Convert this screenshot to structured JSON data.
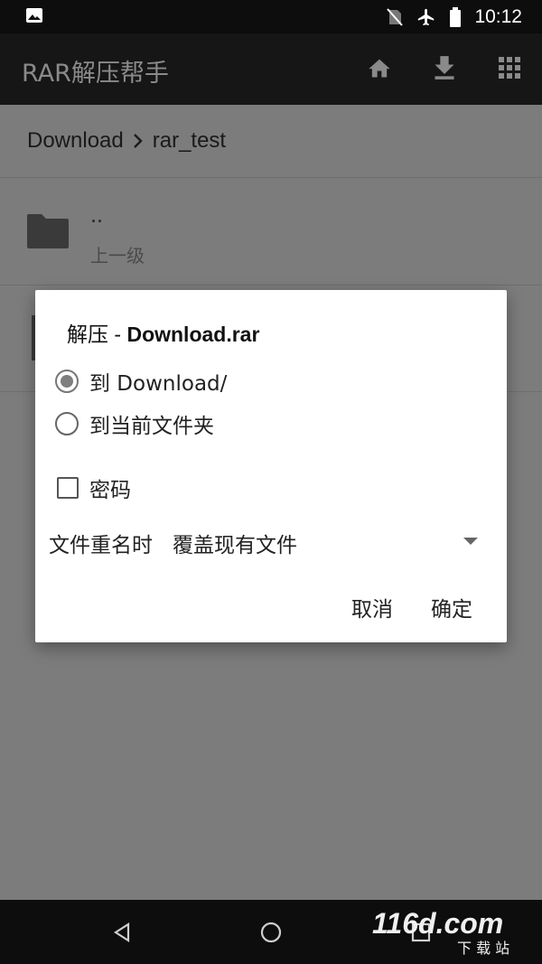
{
  "status": {
    "time": "10:12",
    "left_icon": "image-icon",
    "right_icons": [
      "no-sim-icon",
      "airplane-icon",
      "battery-icon"
    ]
  },
  "app": {
    "title": "RAR解压帮手",
    "actions": [
      "home-icon",
      "download-icon",
      "grid-icon"
    ]
  },
  "breadcrumb": {
    "root": "Download",
    "current": "rar_test"
  },
  "list": {
    "items": [
      {
        "name": "..",
        "sub": "上一级"
      }
    ]
  },
  "dialog": {
    "title_prefix": "解压 - ",
    "title_file": "Download.rar",
    "options": [
      {
        "label": "到 Download/",
        "selected": true
      },
      {
        "label": "到当前文件夹",
        "selected": false
      }
    ],
    "password_label": "密码",
    "rename_label": "文件重名时",
    "rename_value": "覆盖现有文件",
    "cancel": "取消",
    "confirm": "确定"
  },
  "watermark": {
    "text": "116d.com",
    "sub": "下 载 站"
  }
}
